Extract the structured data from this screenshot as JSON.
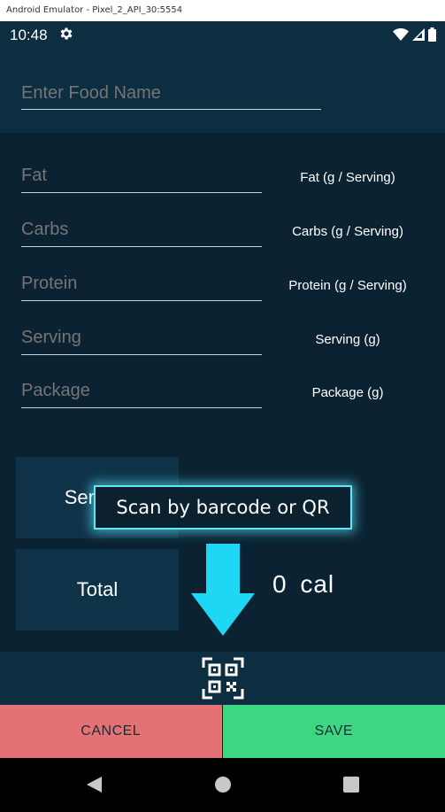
{
  "window": {
    "title": "Android Emulator - Pixel_2_API_30:5554"
  },
  "status_bar": {
    "time": "10:48",
    "icons": [
      "gear-icon",
      "wifi-icon",
      "signal-icon",
      "battery-icon"
    ]
  },
  "food_name": {
    "placeholder": "Enter Food Name",
    "value": ""
  },
  "nutrition_fields": [
    {
      "placeholder": "Fat",
      "hint": "Fat (g / Serving)"
    },
    {
      "placeholder": "Carbs",
      "hint": "Carbs (g / Serving)"
    },
    {
      "placeholder": "Protein",
      "hint": "Protein (g / Serving)"
    },
    {
      "placeholder": "Serving",
      "hint": "Serving (g)"
    },
    {
      "placeholder": "Package",
      "hint": "Package (g)"
    }
  ],
  "buttons": {
    "serving_label": "Serving",
    "total_label": "Total",
    "cancel_label": "CANCEL",
    "save_label": "SAVE"
  },
  "calories": {
    "value": "0",
    "unit": "cal"
  },
  "scan": {
    "tooltip": "Scan by barcode or QR",
    "icon": "qr-scan-icon"
  },
  "colors": {
    "background": "#0a2232",
    "header": "#0d2d40",
    "cancel": "#e47274",
    "save": "#3dd784",
    "highlight": "#5fe8f7"
  }
}
